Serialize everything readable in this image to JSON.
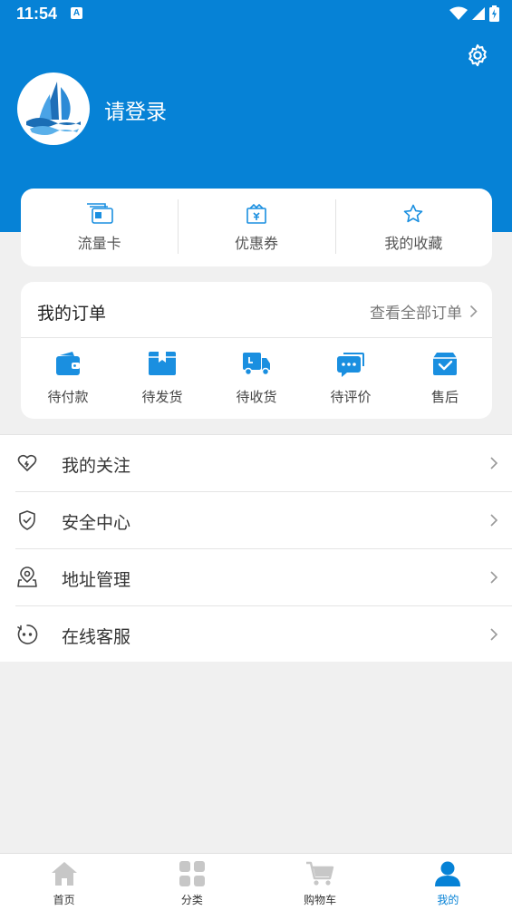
{
  "status_bar": {
    "time": "11:54",
    "notification_badge": "A"
  },
  "colors": {
    "primary": "#0682d6",
    "icon_blue": "#1a8fe0",
    "background": "#f0f0f0"
  },
  "profile": {
    "login_prompt": "请登录"
  },
  "quick_links": [
    {
      "icon": "sim-card-icon",
      "label": "流量卡"
    },
    {
      "icon": "coupon-icon",
      "label": "优惠券"
    },
    {
      "icon": "star-icon",
      "label": "我的收藏"
    }
  ],
  "orders": {
    "title": "我的订单",
    "view_all": "查看全部订单",
    "items": [
      {
        "icon": "wallet-icon",
        "label": "待付款"
      },
      {
        "icon": "package-icon",
        "label": "待发货"
      },
      {
        "icon": "truck-icon",
        "label": "待收货"
      },
      {
        "icon": "comment-icon",
        "label": "待评价"
      },
      {
        "icon": "after-sales-icon",
        "label": "售后"
      }
    ]
  },
  "menu": [
    {
      "icon": "heart-icon",
      "label": "我的关注"
    },
    {
      "icon": "shield-icon",
      "label": "安全中心"
    },
    {
      "icon": "location-icon",
      "label": "地址管理"
    },
    {
      "icon": "customer-service-icon",
      "label": "在线客服"
    }
  ],
  "tabbar": [
    {
      "icon": "home-icon",
      "label": "首页",
      "active": false
    },
    {
      "icon": "category-icon",
      "label": "分类",
      "active": false
    },
    {
      "icon": "cart-icon",
      "label": "购物车",
      "active": false
    },
    {
      "icon": "user-icon",
      "label": "我的",
      "active": true
    }
  ]
}
